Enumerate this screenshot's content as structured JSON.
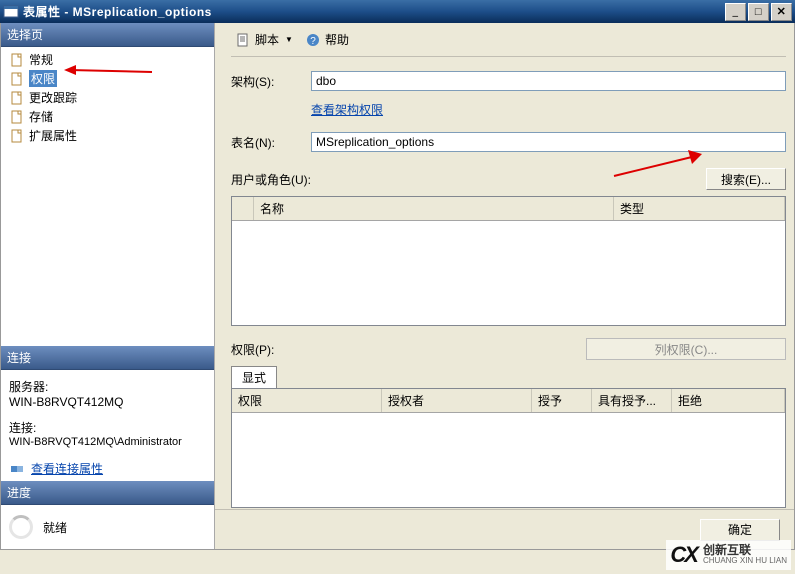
{
  "window": {
    "title": "表属性 - MSreplication_options"
  },
  "sidebar": {
    "select_page_header": "选择页",
    "items": [
      {
        "label": "常规",
        "icon": "page"
      },
      {
        "label": "权限",
        "icon": "page",
        "selected": true
      },
      {
        "label": "更改跟踪",
        "icon": "page"
      },
      {
        "label": "存储",
        "icon": "page"
      },
      {
        "label": "扩展属性",
        "icon": "page"
      }
    ],
    "connection_header": "连接",
    "connection": {
      "server_label": "服务器:",
      "server_value": "WIN-B8RVQT412MQ",
      "conn_label": "连接:",
      "conn_value": "WIN-B8RVQT412MQ\\Administrator",
      "view_props_link": "查看连接属性"
    },
    "progress_header": "进度",
    "progress_status": "就绪"
  },
  "toolbar": {
    "script_label": "脚本",
    "help_label": "帮助"
  },
  "form": {
    "schema_label": "架构(S):",
    "schema_value": "dbo",
    "view_schema_perm_link": "查看架构权限",
    "table_label": "表名(N):",
    "table_value": "MSreplication_options",
    "users_label": "用户或角色(U):",
    "search_button": "搜索(E)..."
  },
  "grid_users": {
    "col_name": "名称",
    "col_type": "类型"
  },
  "permissions": {
    "label": "权限(P):",
    "column_perms_button": "列权限(C)...",
    "tab_explicit": "显式",
    "col_perm": "权限",
    "col_grantor": "授权者",
    "col_grant": "授予",
    "col_withgrant": "具有授予...",
    "col_deny": "拒绝"
  },
  "buttons": {
    "ok": "确定"
  },
  "watermark": {
    "cn": "创新互联",
    "en": "CHUANG XIN HU LIAN"
  }
}
